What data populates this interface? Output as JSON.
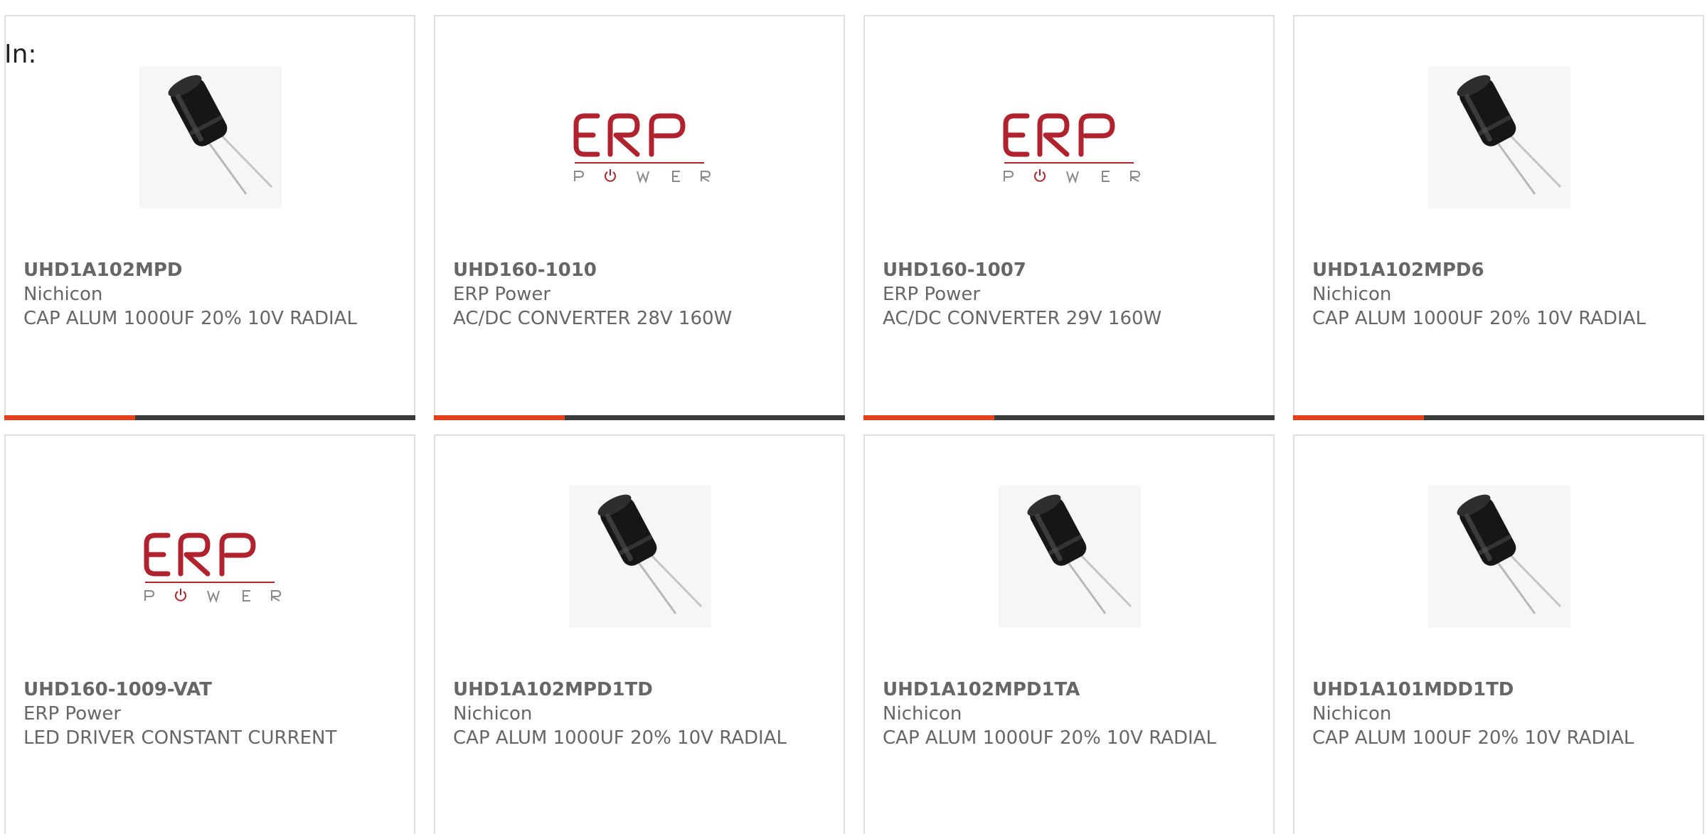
{
  "filter_label": "In:",
  "colors": {
    "accent": "#e8401c",
    "bar_dark": "#3c3c3c",
    "logo_red": "#b0222e",
    "text_gray": "#666666"
  },
  "products": [
    {
      "part": "UHD1A102MPD",
      "manufacturer": "Nichicon",
      "description": "CAP ALUM 1000UF 20% 10V RADIAL",
      "image": "capacitor-photo"
    },
    {
      "part": "UHD160-1010",
      "manufacturer": "ERP Power",
      "description": "AC/DC CONVERTER 28V 160W",
      "image": "erp-power-logo"
    },
    {
      "part": "UHD160-1007",
      "manufacturer": "ERP Power",
      "description": "AC/DC CONVERTER 29V 160W",
      "image": "erp-power-logo"
    },
    {
      "part": "UHD1A102MPD6",
      "manufacturer": "Nichicon",
      "description": "CAP ALUM 1000UF 20% 10V RADIAL",
      "image": "capacitor-photo"
    },
    {
      "part": "UHD160-1009-VAT",
      "manufacturer": "ERP Power",
      "description": "LED DRIVER CONSTANT CURRENT",
      "image": "erp-power-logo"
    },
    {
      "part": "UHD1A102MPD1TD",
      "manufacturer": "Nichicon",
      "description": "CAP ALUM 1000UF 20% 10V RADIAL",
      "image": "capacitor-photo"
    },
    {
      "part": "UHD1A102MPD1TA",
      "manufacturer": "Nichicon",
      "description": "CAP ALUM 1000UF 20% 10V RADIAL",
      "image": "capacitor-photo"
    },
    {
      "part": "UHD1A101MDD1TD",
      "manufacturer": "Nichicon",
      "description": "CAP ALUM 100UF 20% 10V RADIAL",
      "image": "capacitor-photo"
    }
  ]
}
